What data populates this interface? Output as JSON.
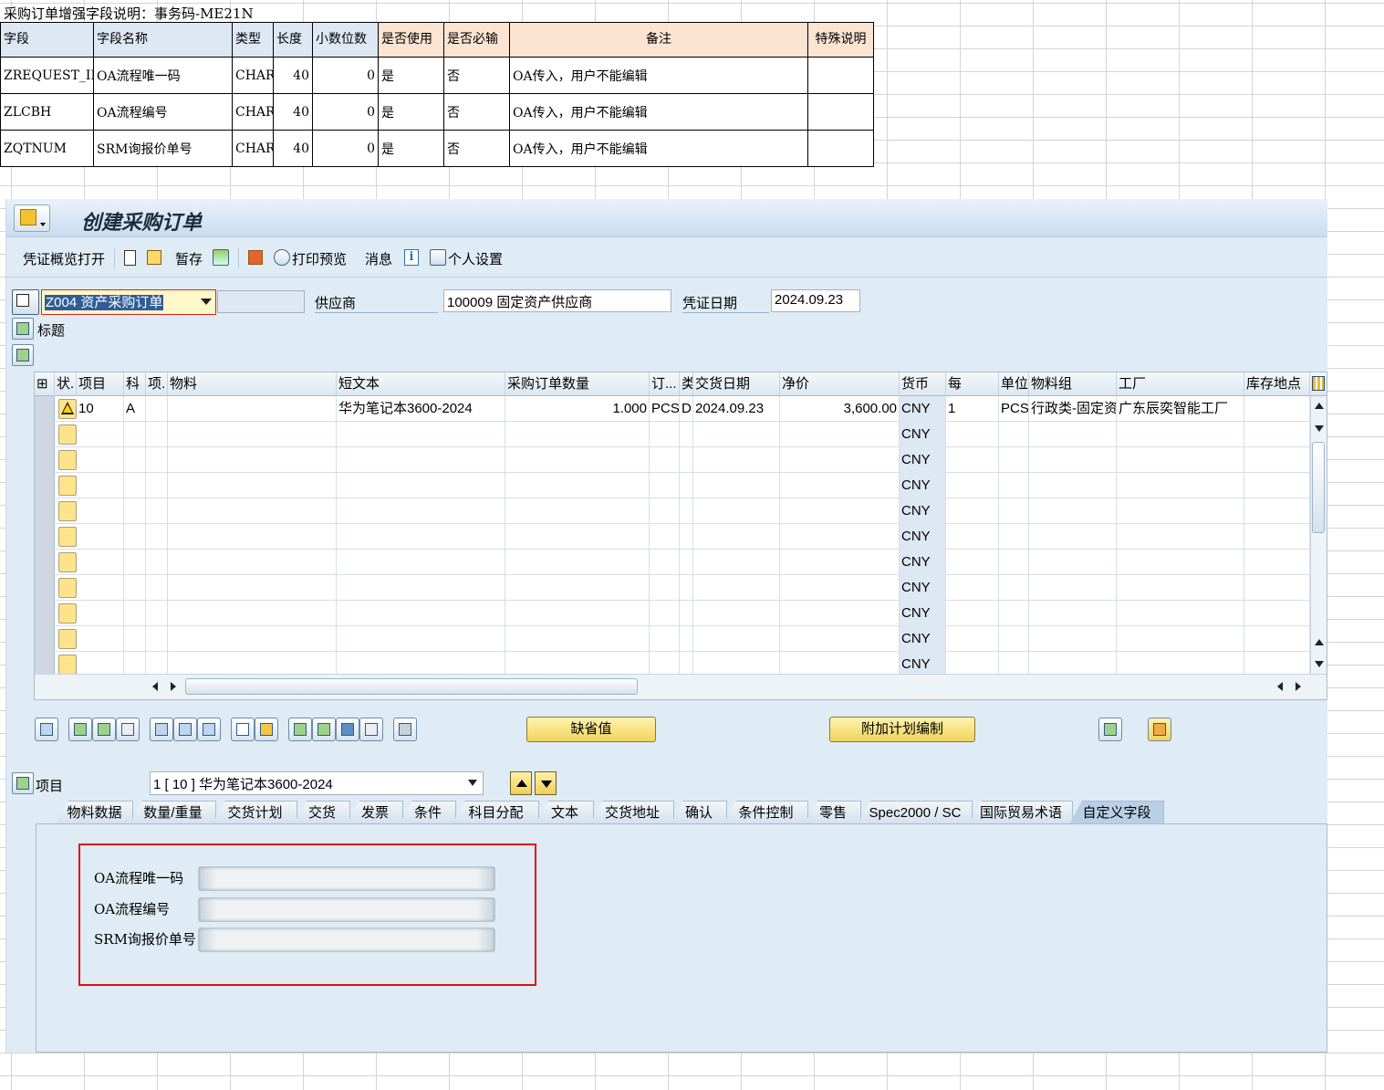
{
  "spec": {
    "title": "采购订单增强字段说明：事务码-ME21N",
    "headers": [
      "字段",
      "字段名称",
      "类型",
      "长度",
      "小数位数",
      "是否使用",
      "是否必输",
      "备注",
      "特殊说明"
    ],
    "rows": [
      [
        "ZREQUEST_ID",
        "OA流程唯一码",
        "CHAR",
        "40",
        "0",
        "是",
        "否",
        "OA传入，用户不能编辑",
        ""
      ],
      [
        "ZLCBH",
        "OA流程编号",
        "CHAR",
        "40",
        "0",
        "是",
        "否",
        "OA传入，用户不能编辑",
        ""
      ],
      [
        "ZQTNUM",
        "SRM询报价单号",
        "CHAR",
        "40",
        "0",
        "是",
        "否",
        "OA传入，用户不能编辑",
        ""
      ]
    ]
  },
  "sap": {
    "title": "创建采购订单",
    "toolbar": {
      "doc_overview": "凭证概览打开",
      "hold": "暂存",
      "print_preview": "打印预览",
      "messages": "消息",
      "personal_settings": "个人设置"
    },
    "header": {
      "doc_type": "Z004 资产采购订单",
      "supplier_label": "供应商",
      "supplier_value": "100009 固定资产供应商",
      "doc_date_label": "凭证日期",
      "doc_date_value": "2024.09.23",
      "header_label": "标题"
    },
    "grid": {
      "columns": [
        "状.",
        "项目",
        "科",
        "项.",
        "物料",
        "短文本",
        "采购订单数量",
        "订...",
        "类",
        "交货日期",
        "净价",
        "货币",
        "每",
        "单位",
        "物料组",
        "工厂",
        "库存地点"
      ],
      "row1": {
        "item": "10",
        "acct": "A",
        "short_text": "华为笔记本3600-2024",
        "qty": "1.000",
        "uom": "PCS",
        "cat": "D",
        "delivery": "2024.09.23",
        "price": "3,600.00",
        "currency": "CNY",
        "per": "1",
        "unit": "PCS",
        "matgroup": "行政类-固定资...",
        "plant": "广东辰奕智能工厂"
      },
      "empty_currency": "CNY"
    },
    "buttons": {
      "default_values": "缺省值",
      "addl_planning": "附加计划编制"
    },
    "item_label": "项目",
    "item_select": "1 [ 10 ] 华为笔记本3600-2024",
    "tabs": [
      "物料数据",
      "数量/重量",
      "交货计划",
      "交货",
      "发票",
      "条件",
      "科目分配",
      "文本",
      "交货地址",
      "确认",
      "条件控制",
      "零售",
      "Spec2000 / SC",
      "国际贸易术语",
      "自定义字段"
    ],
    "custom_fields": {
      "oa_unique": "OA流程唯一码",
      "oa_number": "OA流程编号",
      "srm_number": "SRM询报价单号"
    }
  }
}
